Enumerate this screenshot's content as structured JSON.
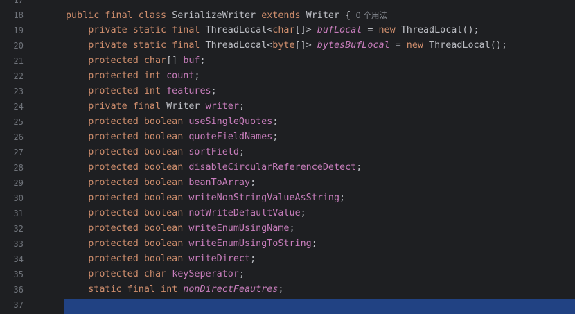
{
  "theme": {
    "background": "#1e1f22",
    "keyword": "#cf8e6d",
    "field": "#c77dbb",
    "text": "#bcbec4",
    "line_number": "#6f737a",
    "selection": "#214283"
  },
  "lines": [
    {
      "number": "17",
      "tokens": []
    },
    {
      "number": "18",
      "tokens": [
        {
          "t": "public final class ",
          "c": "kw"
        },
        {
          "t": "SerializeWriter ",
          "c": "plain"
        },
        {
          "t": "extends ",
          "c": "kw"
        },
        {
          "t": "Writer {",
          "c": "plain"
        },
        {
          "t": "  0 个用法",
          "c": "hint"
        }
      ]
    },
    {
      "number": "19",
      "tokens": [
        {
          "t": "    private static final ",
          "c": "kw"
        },
        {
          "t": "ThreadLocal<",
          "c": "plain"
        },
        {
          "t": "char",
          "c": "kw"
        },
        {
          "t": "[]> ",
          "c": "plain"
        },
        {
          "t": "bufLocal",
          "c": "sfield"
        },
        {
          "t": " = ",
          "c": "plain"
        },
        {
          "t": "new ",
          "c": "kw"
        },
        {
          "t": "ThreadLocal();",
          "c": "plain"
        }
      ]
    },
    {
      "number": "20",
      "tokens": [
        {
          "t": "    private static final ",
          "c": "kw"
        },
        {
          "t": "ThreadLocal<",
          "c": "plain"
        },
        {
          "t": "byte",
          "c": "kw"
        },
        {
          "t": "[]> ",
          "c": "plain"
        },
        {
          "t": "bytesBufLocal",
          "c": "sfield"
        },
        {
          "t": " = ",
          "c": "plain"
        },
        {
          "t": "new ",
          "c": "kw"
        },
        {
          "t": "ThreadLocal();",
          "c": "plain"
        }
      ]
    },
    {
      "number": "21",
      "tokens": [
        {
          "t": "    protected ",
          "c": "kw"
        },
        {
          "t": "char",
          "c": "kw"
        },
        {
          "t": "[] ",
          "c": "plain"
        },
        {
          "t": "buf",
          "c": "field"
        },
        {
          "t": ";",
          "c": "plain"
        }
      ]
    },
    {
      "number": "22",
      "tokens": [
        {
          "t": "    protected int ",
          "c": "kw"
        },
        {
          "t": "count",
          "c": "field"
        },
        {
          "t": ";",
          "c": "plain"
        }
      ]
    },
    {
      "number": "23",
      "tokens": [
        {
          "t": "    protected int ",
          "c": "kw"
        },
        {
          "t": "features",
          "c": "field"
        },
        {
          "t": ";",
          "c": "plain"
        }
      ]
    },
    {
      "number": "24",
      "tokens": [
        {
          "t": "    private final ",
          "c": "kw"
        },
        {
          "t": "Writer ",
          "c": "plain"
        },
        {
          "t": "writer",
          "c": "field"
        },
        {
          "t": ";",
          "c": "plain"
        }
      ]
    },
    {
      "number": "25",
      "tokens": [
        {
          "t": "    protected boolean ",
          "c": "kw"
        },
        {
          "t": "useSingleQuotes",
          "c": "field"
        },
        {
          "t": ";",
          "c": "plain"
        }
      ]
    },
    {
      "number": "26",
      "tokens": [
        {
          "t": "    protected boolean ",
          "c": "kw"
        },
        {
          "t": "quoteFieldNames",
          "c": "field"
        },
        {
          "t": ";",
          "c": "plain"
        }
      ]
    },
    {
      "number": "27",
      "tokens": [
        {
          "t": "    protected boolean ",
          "c": "kw"
        },
        {
          "t": "sortField",
          "c": "field"
        },
        {
          "t": ";",
          "c": "plain"
        }
      ]
    },
    {
      "number": "28",
      "tokens": [
        {
          "t": "    protected boolean ",
          "c": "kw"
        },
        {
          "t": "disableCircularReferenceDetect",
          "c": "field"
        },
        {
          "t": ";",
          "c": "plain"
        }
      ]
    },
    {
      "number": "29",
      "tokens": [
        {
          "t": "    protected boolean ",
          "c": "kw"
        },
        {
          "t": "beanToArray",
          "c": "field"
        },
        {
          "t": ";",
          "c": "plain"
        }
      ]
    },
    {
      "number": "30",
      "tokens": [
        {
          "t": "    protected boolean ",
          "c": "kw"
        },
        {
          "t": "writeNonStringValueAsString",
          "c": "field"
        },
        {
          "t": ";",
          "c": "plain"
        }
      ]
    },
    {
      "number": "31",
      "tokens": [
        {
          "t": "    protected boolean ",
          "c": "kw"
        },
        {
          "t": "notWriteDefaultValue",
          "c": "field"
        },
        {
          "t": ";",
          "c": "plain"
        }
      ]
    },
    {
      "number": "32",
      "tokens": [
        {
          "t": "    protected boolean ",
          "c": "kw"
        },
        {
          "t": "writeEnumUsingName",
          "c": "field"
        },
        {
          "t": ";",
          "c": "plain"
        }
      ]
    },
    {
      "number": "33",
      "tokens": [
        {
          "t": "    protected boolean ",
          "c": "kw"
        },
        {
          "t": "writeEnumUsingToString",
          "c": "field"
        },
        {
          "t": ";",
          "c": "plain"
        }
      ]
    },
    {
      "number": "34",
      "tokens": [
        {
          "t": "    protected boolean ",
          "c": "kw"
        },
        {
          "t": "writeDirect",
          "c": "field"
        },
        {
          "t": ";",
          "c": "plain"
        }
      ]
    },
    {
      "number": "35",
      "tokens": [
        {
          "t": "    protected char ",
          "c": "kw"
        },
        {
          "t": "keySeperator",
          "c": "field"
        },
        {
          "t": ";",
          "c": "plain"
        }
      ]
    },
    {
      "number": "36",
      "tokens": [
        {
          "t": "    static final int ",
          "c": "kw"
        },
        {
          "t": "nonDirectFeautres",
          "c": "sfield"
        },
        {
          "t": ";",
          "c": "plain"
        }
      ]
    },
    {
      "number": "37",
      "tokens": []
    }
  ]
}
